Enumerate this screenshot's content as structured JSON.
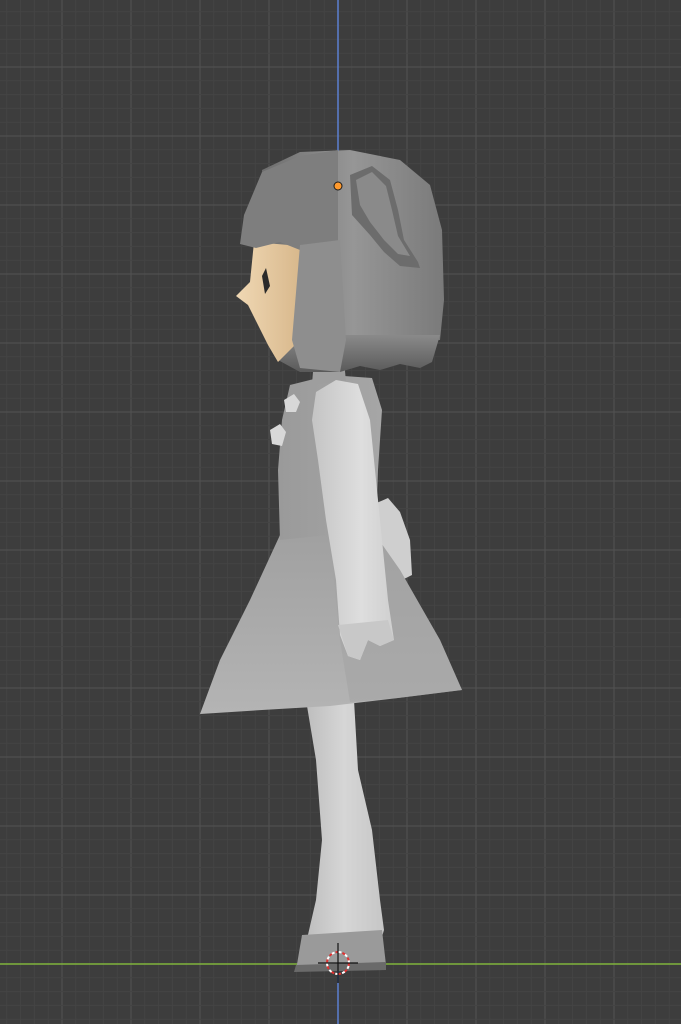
{
  "viewport": {
    "view": "side-orthographic",
    "background_color": "#3d3d3d",
    "grid_minor_color": "#444444",
    "grid_major_color": "#505050",
    "axis_z_color": "#5a7fd0",
    "axis_y_color": "#7fb33a",
    "origin_color": "#ff9a2e",
    "cursor_color": "#e03030"
  },
  "model": {
    "hair_color": "#8c8c8c",
    "skin_color": "#e6c9a0",
    "body_color": "#a8a8a8",
    "limb_color": "#d4d4d4",
    "eye_color": "#2a2a2a"
  }
}
